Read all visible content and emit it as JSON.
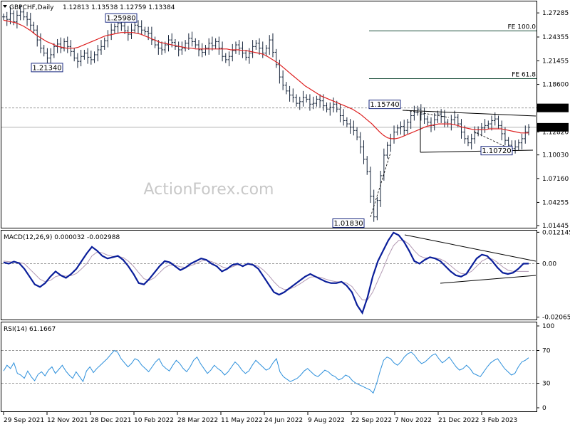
{
  "colors": {
    "ohlc": "#16243a",
    "ma": "#dd1f1f",
    "macd_main": "#0a1e9a",
    "macd_signal": "#b39ab4",
    "rsi": "#2c8fdb",
    "fe_line": "#1a4e3a",
    "annotation_border": "#1a2a80",
    "grid_dash": "#9a9a9a",
    "price_badge_bg": "#000000"
  },
  "chart_data": [
    {
      "type": "candlestick",
      "title": "GBPCHF,Daily",
      "header_values": "1.12813 1.13538 1.12759 1.13384",
      "ylim": [
        1.0118,
        1.2868
      ],
      "y_ticks": [
        "1.27285",
        "1.24355",
        "1.21455",
        "1.18600",
        "1.15740",
        "1.12820",
        "1.10030",
        "1.07160",
        "1.04255",
        "1.01445"
      ],
      "x_labels": [
        "29 Sep 2021",
        "12 Nov 2021",
        "28 Dec 2021",
        "10 Feb 2022",
        "28 Mar 2022",
        "11 May 2022",
        "24 Jun 2022",
        "9 Aug 2022",
        "22 Sep 2022",
        "7 Nov 2022",
        "21 Dec 2022",
        "3 Feb 2023"
      ],
      "current_price": "1.13384",
      "resistance_level": "1.15740",
      "annotations": [
        {
          "label": "1.25980",
          "value": 1.2598
        },
        {
          "label": "1.21340",
          "value": 1.2134
        },
        {
          "label": "1.15740",
          "value": 1.1574
        },
        {
          "label": "1.10720",
          "value": 1.1072
        },
        {
          "label": "1.01830",
          "value": 1.0183
        }
      ],
      "fib_levels": [
        {
          "label": "FE 100.0",
          "value": 1.251
        },
        {
          "label": "FE 61.8",
          "value": 1.193
        }
      ],
      "series": [
        {
          "name": "close",
          "values": [
            1.268,
            1.265,
            1.272,
            1.262,
            1.27,
            1.274,
            1.268,
            1.265,
            1.258,
            1.252,
            1.24,
            1.23,
            1.224,
            1.218,
            1.222,
            1.232,
            1.235,
            1.23,
            1.238,
            1.232,
            1.226,
            1.218,
            1.214,
            1.22,
            1.224,
            1.219,
            1.216,
            1.222,
            1.228,
            1.232,
            1.239,
            1.246,
            1.252,
            1.256,
            1.26,
            1.257,
            1.251,
            1.247,
            1.252,
            1.258,
            1.256,
            1.252,
            1.25,
            1.248,
            1.24,
            1.234,
            1.23,
            1.228,
            1.234,
            1.24,
            1.237,
            1.232,
            1.228,
            1.23,
            1.236,
            1.242,
            1.238,
            1.234,
            1.228,
            1.225,
            1.23,
            1.236,
            1.233,
            1.238,
            1.23,
            1.22,
            1.216,
            1.22,
            1.227,
            1.234,
            1.23,
            1.224,
            1.219,
            1.224,
            1.232,
            1.236,
            1.23,
            1.224,
            1.23,
            1.24,
            1.225,
            1.21,
            1.195,
            1.185,
            1.178,
            1.173,
            1.17,
            1.163,
            1.165,
            1.17,
            1.168,
            1.162,
            1.163,
            1.168,
            1.166,
            1.16,
            1.156,
            1.158,
            1.162,
            1.156,
            1.148,
            1.142,
            1.138,
            1.134,
            1.13,
            1.122,
            1.11,
            1.095,
            1.08,
            1.05,
            1.025,
            1.045,
            1.075,
            1.1,
            1.112,
            1.12,
            1.128,
            1.133,
            1.135,
            1.13,
            1.14,
            1.148,
            1.152,
            1.156,
            1.15,
            1.144,
            1.14,
            1.136,
            1.143,
            1.15,
            1.147,
            1.14,
            1.138,
            1.143,
            1.146,
            1.138,
            1.128,
            1.12,
            1.115,
            1.12,
            1.127,
            1.131,
            1.133,
            1.136,
            1.138,
            1.142,
            1.144,
            1.136,
            1.126,
            1.118,
            1.112,
            1.108,
            1.11,
            1.115,
            1.12,
            1.128,
            1.13384
          ]
        },
        {
          "name": "ma",
          "values": [
            1.264,
            1.263,
            1.262,
            1.261,
            1.259,
            1.257,
            1.254,
            1.251,
            1.247,
            1.244,
            1.241,
            1.238,
            1.236,
            1.234,
            1.232,
            1.231,
            1.23,
            1.23,
            1.23,
            1.231,
            1.233,
            1.235,
            1.237,
            1.239,
            1.241,
            1.243,
            1.245,
            1.246,
            1.247,
            1.248,
            1.249,
            1.249,
            1.249,
            1.249,
            1.248,
            1.247,
            1.245,
            1.243,
            1.241,
            1.239,
            1.237,
            1.236,
            1.235,
            1.234,
            1.233,
            1.232,
            1.231,
            1.23,
            1.23,
            1.229,
            1.229,
            1.229,
            1.229,
            1.229,
            1.229,
            1.229,
            1.229,
            1.229,
            1.228,
            1.228,
            1.228,
            1.227,
            1.227,
            1.226,
            1.225,
            1.224,
            1.223,
            1.221,
            1.218,
            1.215,
            1.212,
            1.208,
            1.204,
            1.2,
            1.196,
            1.192,
            1.188,
            1.184,
            1.181,
            1.178,
            1.175,
            1.172,
            1.17,
            1.168,
            1.166,
            1.164,
            1.162,
            1.16,
            1.158,
            1.156,
            1.153,
            1.15,
            1.146,
            1.142,
            1.138,
            1.133,
            1.128,
            1.124,
            1.121,
            1.12,
            1.12,
            1.121,
            1.123,
            1.125,
            1.127,
            1.129,
            1.131,
            1.133,
            1.135,
            1.136,
            1.137,
            1.138,
            1.138,
            1.138,
            1.138,
            1.137,
            1.136,
            1.134,
            1.133,
            1.132,
            1.131,
            1.131,
            1.131,
            1.131,
            1.132,
            1.132,
            1.132,
            1.132,
            1.131,
            1.13,
            1.129,
            1.128,
            1.127,
            1.127,
            1.127
          ]
        }
      ]
    },
    {
      "type": "line",
      "title": "MACD(12,26,9) 0.000032 -0.002988",
      "ylim": [
        -0.0216,
        0.0128
      ],
      "y_ticks": [
        "0.012145",
        "0.00",
        "-0.020656"
      ],
      "series": [
        {
          "name": "MACD",
          "values": [
            0.0005,
            0.0,
            0.0008,
            0.0002,
            -0.002,
            -0.005,
            -0.008,
            -0.009,
            -0.0075,
            -0.005,
            -0.003,
            -0.0045,
            -0.0055,
            -0.004,
            -0.002,
            0.001,
            0.004,
            0.0065,
            0.005,
            0.003,
            0.002,
            0.0025,
            0.003,
            0.0015,
            -0.001,
            -0.004,
            -0.0075,
            -0.008,
            -0.006,
            -0.0035,
            -0.001,
            0.001,
            0.0005,
            -0.001,
            -0.0025,
            -0.0015,
            0.0,
            0.001,
            0.002,
            0.0015,
            0.0,
            -0.001,
            -0.003,
            -0.002,
            -0.0005,
            0.0,
            -0.001,
            0.0,
            -0.0005,
            -0.002,
            -0.005,
            -0.008,
            -0.011,
            -0.012,
            -0.011,
            -0.0095,
            -0.008,
            -0.0065,
            -0.005,
            -0.004,
            -0.005,
            -0.006,
            -0.007,
            -0.0075,
            -0.0075,
            -0.007,
            -0.0085,
            -0.011,
            -0.016,
            -0.019,
            -0.013,
            -0.005,
            0.001,
            0.005,
            0.009,
            0.012,
            0.011,
            0.0085,
            0.005,
            0.001,
            0.0,
            0.0015,
            0.0025,
            0.002,
            0.001,
            -0.001,
            -0.003,
            -0.0045,
            -0.005,
            -0.004,
            -0.001,
            0.002,
            0.0035,
            0.003,
            0.001,
            -0.0015,
            -0.0035,
            -0.004,
            -0.0035,
            -0.002,
            0.0,
            3e-05
          ]
        },
        {
          "name": "Signal",
          "values": [
            0.001,
            0.0008,
            0.0006,
            0.0005,
            0.0,
            -0.002,
            -0.004,
            -0.006,
            -0.007,
            -0.0065,
            -0.005,
            -0.0045,
            -0.0048,
            -0.0046,
            -0.0038,
            -0.002,
            0.0,
            0.003,
            0.0045,
            0.0042,
            0.0033,
            0.0028,
            0.0028,
            0.0024,
            0.001,
            -0.001,
            -0.0035,
            -0.0058,
            -0.0065,
            -0.0055,
            -0.0035,
            -0.0015,
            -0.0005,
            -0.0006,
            -0.0012,
            -0.0014,
            -0.0008,
            0.0,
            0.001,
            0.0013,
            0.0008,
            0.0,
            -0.0012,
            -0.0018,
            -0.0012,
            -0.0005,
            -0.0007,
            -0.0003,
            -0.0004,
            -0.001,
            -0.0025,
            -0.0045,
            -0.007,
            -0.009,
            -0.01,
            -0.0098,
            -0.009,
            -0.0078,
            -0.0065,
            -0.0052,
            -0.005,
            -0.0053,
            -0.006,
            -0.0066,
            -0.007,
            -0.007,
            -0.0075,
            -0.0088,
            -0.0115,
            -0.014,
            -0.014,
            -0.011,
            -0.0065,
            -0.002,
            0.003,
            0.007,
            0.009,
            0.009,
            0.0075,
            0.005,
            0.003,
            0.0022,
            0.0023,
            0.0022,
            0.0018,
            0.0008,
            -0.0008,
            -0.0025,
            -0.0038,
            -0.004,
            -0.003,
            -0.001,
            0.001,
            0.002,
            0.0018,
            0.0005,
            -0.0012,
            -0.0025,
            -0.003,
            -0.003,
            -0.003,
            -0.002988
          ]
        }
      ]
    },
    {
      "type": "line",
      "title": "RSI(14) 61.1667",
      "ylim": [
        0,
        100
      ],
      "y_ticks": [
        "100",
        "70",
        "30",
        "0"
      ],
      "levels": [
        70,
        30
      ],
      "series": [
        {
          "name": "RSI",
          "values": [
            45,
            52,
            48,
            55,
            42,
            40,
            36,
            45,
            38,
            33,
            41,
            44,
            39,
            46,
            50,
            42,
            47,
            52,
            45,
            40,
            36,
            44,
            38,
            32,
            45,
            50,
            43,
            48,
            52,
            56,
            60,
            65,
            70,
            68,
            60,
            55,
            50,
            54,
            60,
            58,
            52,
            48,
            44,
            50,
            56,
            60,
            52,
            48,
            45,
            52,
            58,
            54,
            48,
            44,
            50,
            58,
            62,
            54,
            48,
            42,
            46,
            52,
            48,
            45,
            40,
            44,
            50,
            56,
            52,
            46,
            42,
            45,
            52,
            58,
            54,
            50,
            46,
            48,
            55,
            60,
            44,
            38,
            35,
            32,
            34,
            36,
            40,
            45,
            48,
            44,
            40,
            38,
            42,
            46,
            44,
            40,
            38,
            34,
            36,
            40,
            38,
            33,
            30,
            28,
            26,
            24,
            22,
            18,
            30,
            45,
            58,
            62,
            60,
            55,
            52,
            56,
            62,
            66,
            68,
            64,
            58,
            54,
            56,
            60,
            64,
            66,
            60,
            55,
            58,
            62,
            56,
            50,
            46,
            48,
            52,
            48,
            42,
            40,
            38,
            44,
            50,
            55,
            58,
            60,
            54,
            48,
            44,
            40,
            42,
            50,
            56,
            58,
            61.1667
          ]
        }
      ]
    }
  ],
  "watermark": "ActionForex.com"
}
